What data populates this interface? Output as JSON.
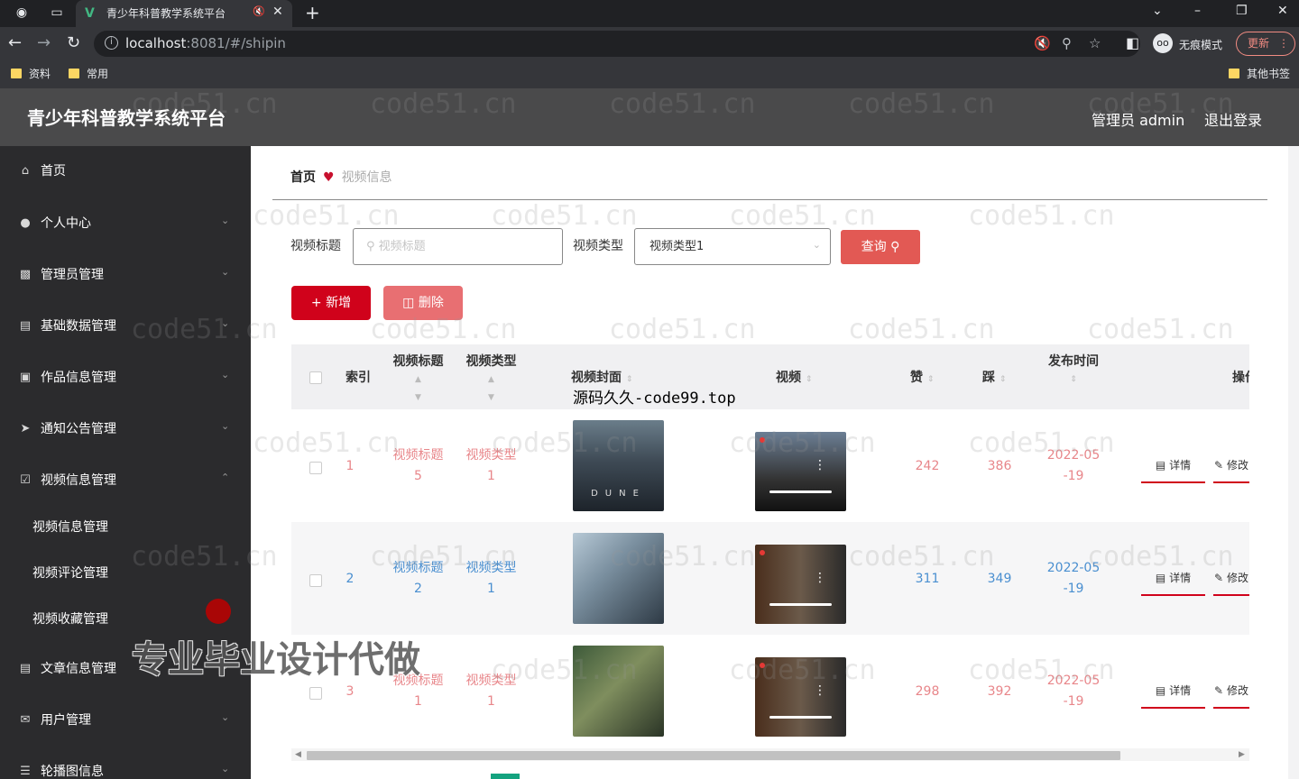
{
  "browser": {
    "tab_title": "青少年科普教学系统平台",
    "url_host": "localhost",
    "url_rest": ":8081/#/shipin",
    "incognito_label": "无痕模式",
    "update_label": "更新",
    "bookmarks": [
      "资料",
      "常用"
    ],
    "other_bookmarks": "其他书签"
  },
  "header": {
    "title": "青少年科普教学系统平台",
    "user": "管理员 admin",
    "logout": "退出登录"
  },
  "sidebar": {
    "items": [
      {
        "label": "首页",
        "icon": "home-icon"
      },
      {
        "label": "个人中心",
        "icon": "user-icon"
      },
      {
        "label": "管理员管理",
        "icon": "briefcase-icon"
      },
      {
        "label": "基础数据管理",
        "icon": "stack-icon"
      },
      {
        "label": "作品信息管理",
        "icon": "chat-icon"
      },
      {
        "label": "通知公告管理",
        "icon": "send-icon"
      },
      {
        "label": "视频信息管理",
        "icon": "checklist-icon"
      },
      {
        "label": "文章信息管理",
        "icon": "document-icon"
      },
      {
        "label": "用户管理",
        "icon": "mail-icon"
      },
      {
        "label": "轮播图信息",
        "icon": "list-icon"
      }
    ],
    "submenu": [
      "视频信息管理",
      "视频评论管理",
      "视频收藏管理"
    ]
  },
  "breadcrumb": {
    "home": "首页",
    "current": "视频信息"
  },
  "search": {
    "title_label": "视频标题",
    "title_placeholder": "视频标题",
    "type_label": "视频类型",
    "type_value": "视频类型1",
    "query_button": "查询"
  },
  "toolbar": {
    "add": "新增",
    "delete": "删除"
  },
  "table": {
    "headers": {
      "index": "索引",
      "title": "视频标题",
      "type": "视频类型",
      "cover": "视频封面",
      "video": "视频",
      "likes": "赞",
      "dislikes": "踩",
      "publish": "发布时间",
      "ops": "操作"
    },
    "rows": [
      {
        "index": "1",
        "title": [
          "视频标题",
          "5"
        ],
        "type": [
          "视频类型",
          "1"
        ],
        "likes": "242",
        "dislikes": "386",
        "publish": [
          "2022-05",
          "-19"
        ],
        "color": "#e8868a"
      },
      {
        "index": "2",
        "title": [
          "视频标题",
          "2"
        ],
        "type": [
          "视频类型",
          "1"
        ],
        "likes": "311",
        "dislikes": "349",
        "publish": [
          "2022-05",
          "-19"
        ],
        "color": "#4a8fd0"
      },
      {
        "index": "3",
        "title": [
          "视频标题",
          "1"
        ],
        "type": [
          "视频类型",
          "1"
        ],
        "likes": "298",
        "dislikes": "392",
        "publish": [
          "2022-05",
          "-19"
        ],
        "color": "#e8868a"
      }
    ],
    "detail_label": "详情",
    "edit_label": "修改"
  },
  "cover_text": "DUNE",
  "overlays": {
    "top": "源码久久-code99.top",
    "big": "专业毕业设计代做",
    "watermark": "code51.cn"
  }
}
